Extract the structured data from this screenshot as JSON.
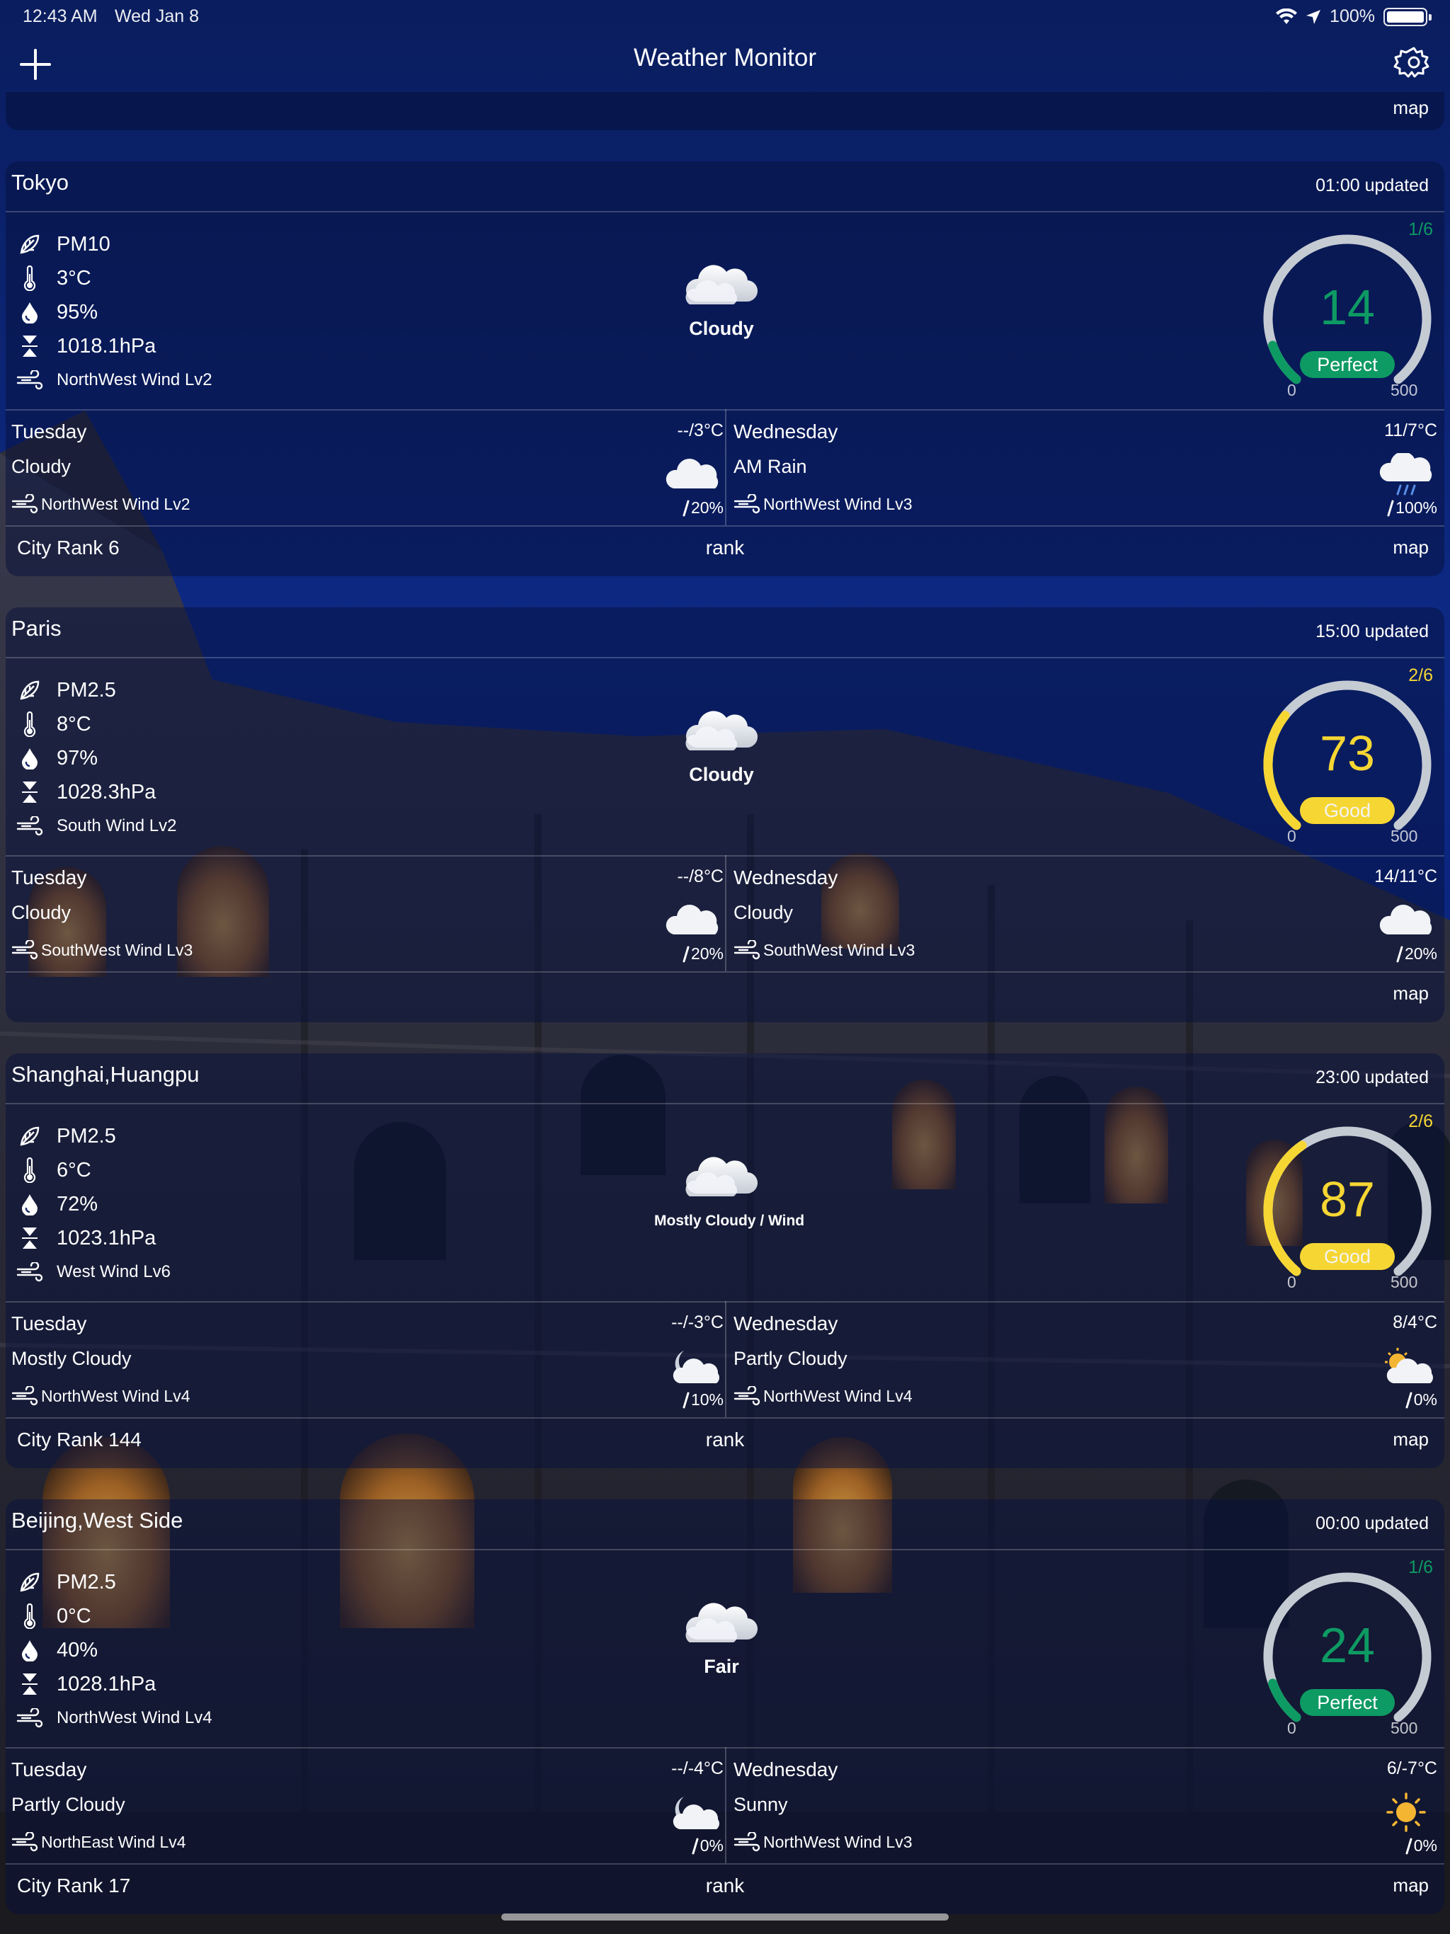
{
  "status_bar": {
    "time": "12:43 AM",
    "date": "Wed Jan 8",
    "battery": "100%"
  },
  "nav": {
    "title": "Weather Monitor"
  },
  "icons": {
    "add": "plus-icon",
    "settings": "gear-icon",
    "pollutant": "leaf-icon",
    "temperature": "thermometer-icon",
    "humidity": "drop-icon",
    "pressure": "pressure-icon",
    "wind": "wind-icon",
    "precipitation": "raindrop-icon"
  },
  "colors": {
    "perfect": "#0e9a63",
    "good": "#f6d633",
    "gauge_track": "#c5cbd3"
  },
  "top_partial": {
    "map_label": "map"
  },
  "cards": [
    {
      "city": "Tokyo",
      "updated": "01:00 updated",
      "pollutant": "PM10",
      "temp": "3°C",
      "humidity": "95%",
      "pressure": "1018.1hPa",
      "wind": "NorthWest Wind Lv2",
      "now_label": "Cloudy",
      "gauge": {
        "page": "1/6",
        "value": "14",
        "rating": "Perfect",
        "min": "0",
        "max": "500",
        "level": 14
      },
      "forecast": [
        {
          "day": "Tuesday",
          "temp": "--/3°C",
          "cond": "Cloudy",
          "wind": "NorthWest Wind Lv2",
          "precip": "20%",
          "icon": "cloud"
        },
        {
          "day": "Wednesday",
          "temp": "11/7°C",
          "cond": "AM Rain",
          "wind": "NorthWest Wind Lv3",
          "precip": "100%",
          "icon": "rain"
        }
      ],
      "bottom": {
        "rank": "City Rank 6",
        "rank_link": "rank",
        "map": "map"
      }
    },
    {
      "city": "Paris",
      "updated": "15:00 updated",
      "pollutant": "PM2.5",
      "temp": "8°C",
      "humidity": "97%",
      "pressure": "1028.3hPa",
      "wind": "South Wind Lv2",
      "now_label": "Cloudy",
      "gauge": {
        "page": "2/6",
        "value": "73",
        "rating": "Good",
        "min": "0",
        "max": "500",
        "level": 73
      },
      "forecast": [
        {
          "day": "Tuesday",
          "temp": "--/8°C",
          "cond": "Cloudy",
          "wind": "SouthWest Wind Lv3",
          "precip": "20%",
          "icon": "cloud"
        },
        {
          "day": "Wednesday",
          "temp": "14/11°C",
          "cond": "Cloudy",
          "wind": "SouthWest Wind Lv3",
          "precip": "20%",
          "icon": "cloud"
        }
      ],
      "bottom": {
        "rank": "",
        "rank_link": "",
        "map": "map"
      }
    },
    {
      "city": "Shanghai,Huangpu",
      "updated": "23:00 updated",
      "pollutant": "PM2.5",
      "temp": "6°C",
      "humidity": "72%",
      "pressure": "1023.1hPa",
      "wind": "West Wind Lv6",
      "now_label": "Mostly Cloudy / Wind",
      "gauge": {
        "page": "2/6",
        "value": "87",
        "rating": "Good",
        "min": "0",
        "max": "500",
        "level": 87
      },
      "forecast": [
        {
          "day": "Tuesday",
          "temp": "--/-3°C",
          "cond": "Mostly Cloudy",
          "wind": "NorthWest Wind Lv4",
          "precip": "10%",
          "icon": "moon-cloud"
        },
        {
          "day": "Wednesday",
          "temp": "8/4°C",
          "cond": "Partly Cloudy",
          "wind": "NorthWest Wind Lv4",
          "precip": "0%",
          "icon": "sun-cloud"
        }
      ],
      "bottom": {
        "rank": "City Rank 144",
        "rank_link": "rank",
        "map": "map"
      }
    },
    {
      "city": "Beijing,West Side",
      "updated": "00:00 updated",
      "pollutant": "PM2.5",
      "temp": "0°C",
      "humidity": "40%",
      "pressure": "1028.1hPa",
      "wind": "NorthWest Wind Lv4",
      "now_label": "Fair",
      "gauge": {
        "page": "1/6",
        "value": "24",
        "rating": "Perfect",
        "min": "0",
        "max": "500",
        "level": 24
      },
      "forecast": [
        {
          "day": "Tuesday",
          "temp": "--/-4°C",
          "cond": "Partly Cloudy",
          "wind": "NorthEast Wind Lv4",
          "precip": "0%",
          "icon": "moon-cloud"
        },
        {
          "day": "Wednesday",
          "temp": "6/-7°C",
          "cond": "Sunny",
          "wind": "NorthWest Wind Lv3",
          "precip": "0%",
          "icon": "sun"
        }
      ],
      "bottom": {
        "rank": "City Rank 17",
        "rank_link": "rank",
        "map": "map"
      }
    }
  ]
}
